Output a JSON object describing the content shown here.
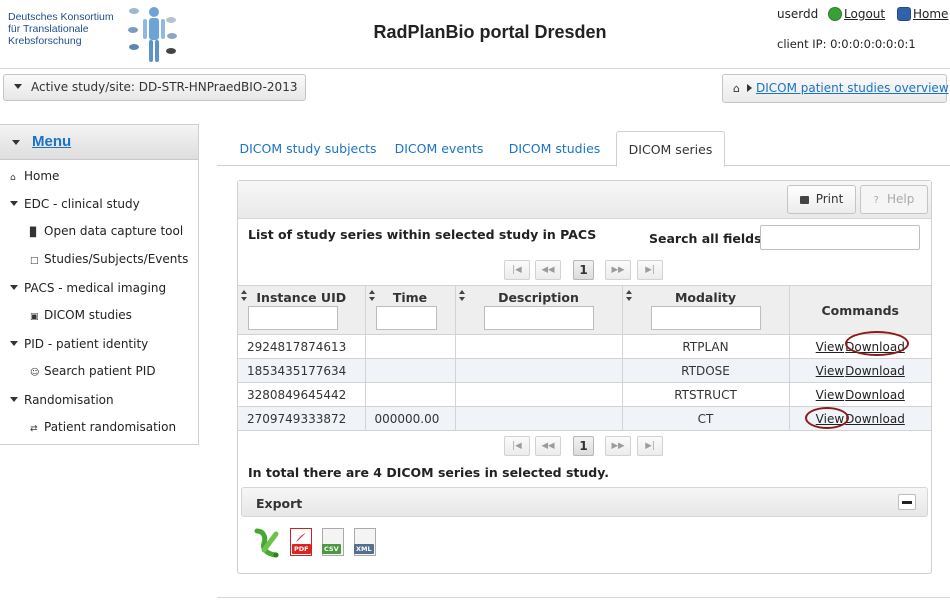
{
  "header": {
    "logo_lines": [
      "Deutsches Konsortium",
      "für Translationale",
      "Krebsforschung"
    ],
    "title": "RadPlanBio portal Dresden",
    "username": "userdd",
    "logout_label": "Logout",
    "home_label": "Home",
    "client_ip": "client IP: 0:0:0:0:0:0:0:1"
  },
  "study_selector": {
    "label": "Active study/site: DD-STR-HNPraedBIO-2013"
  },
  "breadcrumb": {
    "link": "DICOM patient studies overview"
  },
  "menu": {
    "title": "Menu",
    "items": [
      {
        "label": "Home",
        "icon": "home-icon",
        "level": 0
      },
      {
        "label": "EDC - clinical study",
        "icon": "expand-arrow-icon",
        "level": 0
      },
      {
        "label": "Open data capture tool",
        "icon": "clipboard-icon",
        "level": 1
      },
      {
        "label": "Studies/Subjects/Events",
        "icon": "document-icon",
        "level": 1
      },
      {
        "label": "PACS - medical imaging",
        "icon": "expand-arrow-icon",
        "level": 0
      },
      {
        "label": "DICOM studies",
        "icon": "image-icon",
        "level": 1
      },
      {
        "label": "PID - patient identity",
        "icon": "expand-arrow-icon",
        "level": 0
      },
      {
        "label": "Search patient PID",
        "icon": "person-icon",
        "level": 1
      },
      {
        "label": "Randomisation",
        "icon": "expand-arrow-icon",
        "level": 0
      },
      {
        "label": "Patient randomisation",
        "icon": "shuffle-icon",
        "level": 1
      }
    ]
  },
  "tabs": [
    {
      "label": "DICOM study subjects",
      "active": false
    },
    {
      "label": "DICOM events",
      "active": false
    },
    {
      "label": "DICOM studies",
      "active": false
    },
    {
      "label": "DICOM series",
      "active": true
    }
  ],
  "toolbar": {
    "print_label": "Print",
    "help_label": "Help"
  },
  "table": {
    "caption": "List of study series within selected study in PACS",
    "search_label": "Search all fields:",
    "search_value": "",
    "current_page": "1",
    "columns": [
      "Instance UID",
      "Time",
      "Description",
      "Modality",
      "Commands"
    ],
    "rows": [
      {
        "uid": "2924817874613",
        "time": "",
        "description": "",
        "modality": "RTPLAN"
      },
      {
        "uid": "1853435177634",
        "time": "",
        "description": "",
        "modality": "RTDOSE"
      },
      {
        "uid": "3280849645442",
        "time": "",
        "description": "",
        "modality": "RTSTRUCT"
      },
      {
        "uid": "2709749333872",
        "time": "000000.00",
        "description": "",
        "modality": "CT"
      }
    ],
    "view_label": "View",
    "download_label": "Download"
  },
  "summary": "In total there are 4 DICOM series in selected study.",
  "export": {
    "title": "Export",
    "formats": [
      {
        "name": "excel-export-icon",
        "tag": ""
      },
      {
        "name": "pdf-export-icon",
        "tag": "PDF"
      },
      {
        "name": "csv-export-icon",
        "tag": "CSV"
      },
      {
        "name": "xml-export-icon",
        "tag": "XML"
      }
    ]
  },
  "colors": {
    "link": "#1a73c8",
    "accent_blue": "#2f62a8",
    "annotation_circle": "#8b1a1a",
    "alt_row": "#f0f3f8"
  }
}
